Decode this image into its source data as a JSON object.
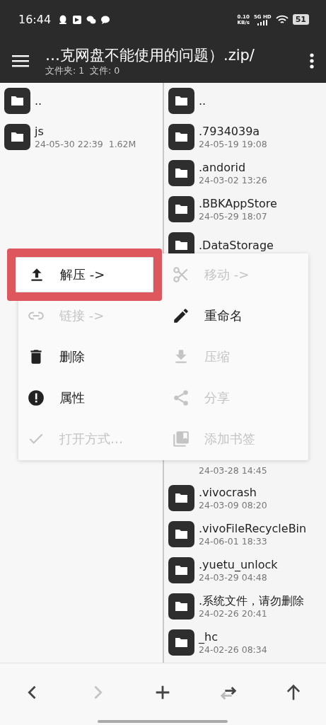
{
  "status_bar": {
    "time": "16:44",
    "net_speed": "0.10",
    "net_unit": "KB/s",
    "network": "5G HD",
    "battery": "51"
  },
  "toolbar": {
    "title": "…克网盘不能使用的问题）.zip/",
    "subtitle": "文件夹: 1  文件: 0"
  },
  "left_pane": {
    "items": [
      {
        "kind": "folder",
        "name": ".."
      },
      {
        "kind": "folder",
        "name": "js",
        "date": "24-05-30 22:39",
        "size": "1.62M"
      }
    ]
  },
  "right_pane": {
    "items": [
      {
        "kind": "folder",
        "name": ".."
      },
      {
        "kind": "folder",
        "name": ".7934039a",
        "date": "24-05-19 19:08"
      },
      {
        "kind": "folder",
        "name": ".andorid",
        "date": "24-03-02 13:26"
      },
      {
        "kind": "folder",
        "name": ".BBKAppStore",
        "date": "24-05-29 18:07"
      },
      {
        "kind": "folder",
        "name": ".DataStorage"
      },
      {
        "kind": "covered"
      },
      {
        "kind": "covered"
      },
      {
        "kind": "covered"
      },
      {
        "kind": "covered"
      },
      {
        "kind": "covered"
      },
      {
        "kind": "folder",
        "date": "24-03-28 14:45"
      },
      {
        "kind": "folder",
        "name": ".vivocrash",
        "date": "24-03-09 08:20"
      },
      {
        "kind": "folder",
        "name": ".vivoFileRecycleBin",
        "date": "24-06-01 18:33"
      },
      {
        "kind": "folder",
        "name": ".yuetu_unlock",
        "date": "24-03-29 04:48"
      },
      {
        "kind": "folder",
        "name": ".系统文件，请勿删除",
        "date": "24-02-26 20:41"
      },
      {
        "kind": "folder",
        "name": "_hc",
        "date": "24-02-26 08:34"
      }
    ]
  },
  "context_menu": {
    "items": [
      {
        "label": "解压 ->",
        "disabled": false,
        "highlighted": true
      },
      {
        "label": "移动 ->",
        "disabled": true,
        "highlighted": false
      },
      {
        "label": "链接 ->",
        "disabled": true,
        "highlighted": false
      },
      {
        "label": "重命名",
        "disabled": false,
        "highlighted": false
      },
      {
        "label": "删除",
        "disabled": false,
        "highlighted": false
      },
      {
        "label": "压缩",
        "disabled": true,
        "highlighted": false
      },
      {
        "label": "属性",
        "disabled": false,
        "highlighted": false
      },
      {
        "label": "分享",
        "disabled": true,
        "highlighted": false
      },
      {
        "label": "打开方式…",
        "disabled": true,
        "highlighted": false
      },
      {
        "label": "添加书签",
        "disabled": true,
        "highlighted": false
      }
    ]
  },
  "bottom_bar": {
    "buttons": [
      {
        "disabled": false
      },
      {
        "disabled": true
      },
      {
        "disabled": false
      },
      {
        "disabled": false
      },
      {
        "disabled": false
      }
    ]
  }
}
